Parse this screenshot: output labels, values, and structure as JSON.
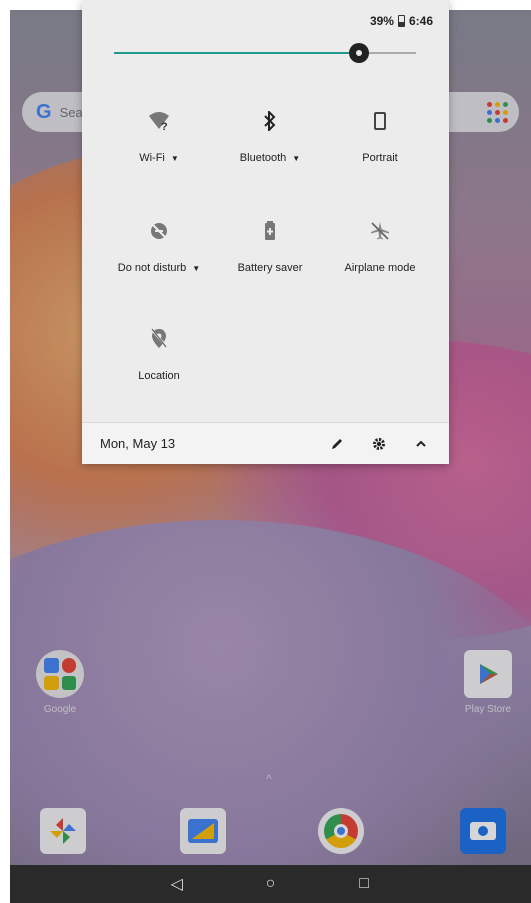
{
  "status_bar": {
    "battery": "39%",
    "time": "6:46"
  },
  "brightness": {
    "level": 0.81
  },
  "search": {
    "placeholder": "Sear"
  },
  "tiles": [
    {
      "label": "Wi-Fi",
      "icon": "wifi-question-icon",
      "dropdown": true
    },
    {
      "label": "Bluetooth",
      "icon": "bluetooth-icon",
      "dropdown": true
    },
    {
      "label": "Portrait",
      "icon": "portrait-icon",
      "dropdown": false
    },
    {
      "label": "Do not disturb",
      "icon": "do-not-disturb-icon",
      "dropdown": true
    },
    {
      "label": "Battery saver",
      "icon": "battery-saver-icon",
      "dropdown": false
    },
    {
      "label": "Airplane mode",
      "icon": "airplane-mode-icon",
      "dropdown": false
    },
    {
      "label": "Location",
      "icon": "location-off-icon",
      "dropdown": false
    }
  ],
  "footer": {
    "date": "Mon, May 13"
  },
  "home": {
    "apps": [
      {
        "name": "Google",
        "icon": "google-folder-icon"
      },
      {
        "name": "Play Store",
        "icon": "play-store-icon"
      }
    ],
    "dock": [
      "photos-icon",
      "files-icon",
      "chrome-icon",
      "camera-icon"
    ]
  },
  "navbar": {
    "back": "◁",
    "home": "○",
    "recents": "□"
  },
  "colors": {
    "accent": "#1d9a8c",
    "shade_bg": "#ececec"
  }
}
